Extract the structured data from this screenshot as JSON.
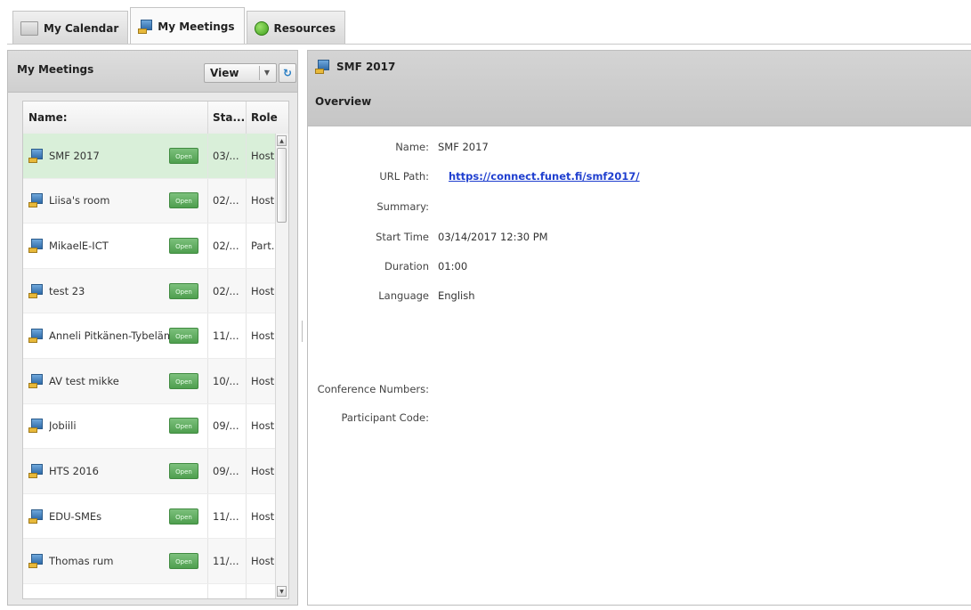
{
  "tabs": [
    {
      "label": "My Calendar",
      "icon": "calendar-icon",
      "active": false
    },
    {
      "label": "My Meetings",
      "icon": "meeting-icon",
      "active": true
    },
    {
      "label": "Resources",
      "icon": "resources-icon",
      "active": false
    }
  ],
  "left_panel": {
    "title": "My Meetings",
    "view_select": {
      "selected": "View"
    },
    "columns": {
      "name": "Name:",
      "start": "Sta...",
      "role": "Role"
    },
    "open_label": "Open",
    "rows": [
      {
        "name": "SMF 2017",
        "start": "03/...",
        "role": "Host",
        "selected": true
      },
      {
        "name": "Liisa's room",
        "start": "02/...",
        "role": "Host"
      },
      {
        "name": "MikaelE-ICT",
        "start": "02/...",
        "role": "Part..."
      },
      {
        "name": "test 23",
        "start": "02/...",
        "role": "Host"
      },
      {
        "name": "Anneli Pitkänen-Tybeläm...",
        "start": "11/...",
        "role": "Host"
      },
      {
        "name": "AV test mikke",
        "start": "10/...",
        "role": "Host"
      },
      {
        "name": "Jobiili",
        "start": "09/...",
        "role": "Host"
      },
      {
        "name": "HTS 2016",
        "start": "09/...",
        "role": "Host"
      },
      {
        "name": "EDU-SMEs",
        "start": "11/...",
        "role": "Host"
      },
      {
        "name": "Thomas rum",
        "start": "11/...",
        "role": "Host"
      },
      {
        "name": "",
        "start": "",
        "role": ""
      }
    ]
  },
  "right_panel": {
    "meeting_title": "SMF 2017",
    "section": "Overview",
    "details": {
      "name_label": "Name:",
      "name_value": "SMF 2017",
      "url_label": "URL Path:",
      "url_value": "https://connect.funet.fi/smf2017/",
      "summary_label": "Summary:",
      "summary_value": "",
      "start_label": "Start Time",
      "start_value": "03/14/2017 12:30 PM",
      "duration_label": "Duration",
      "duration_value": "01:00",
      "language_label": "Language",
      "language_value": "English",
      "conf_label": "Conference Numbers:",
      "conf_value": "",
      "participant_label": "Participant Code:",
      "participant_value": ""
    }
  }
}
